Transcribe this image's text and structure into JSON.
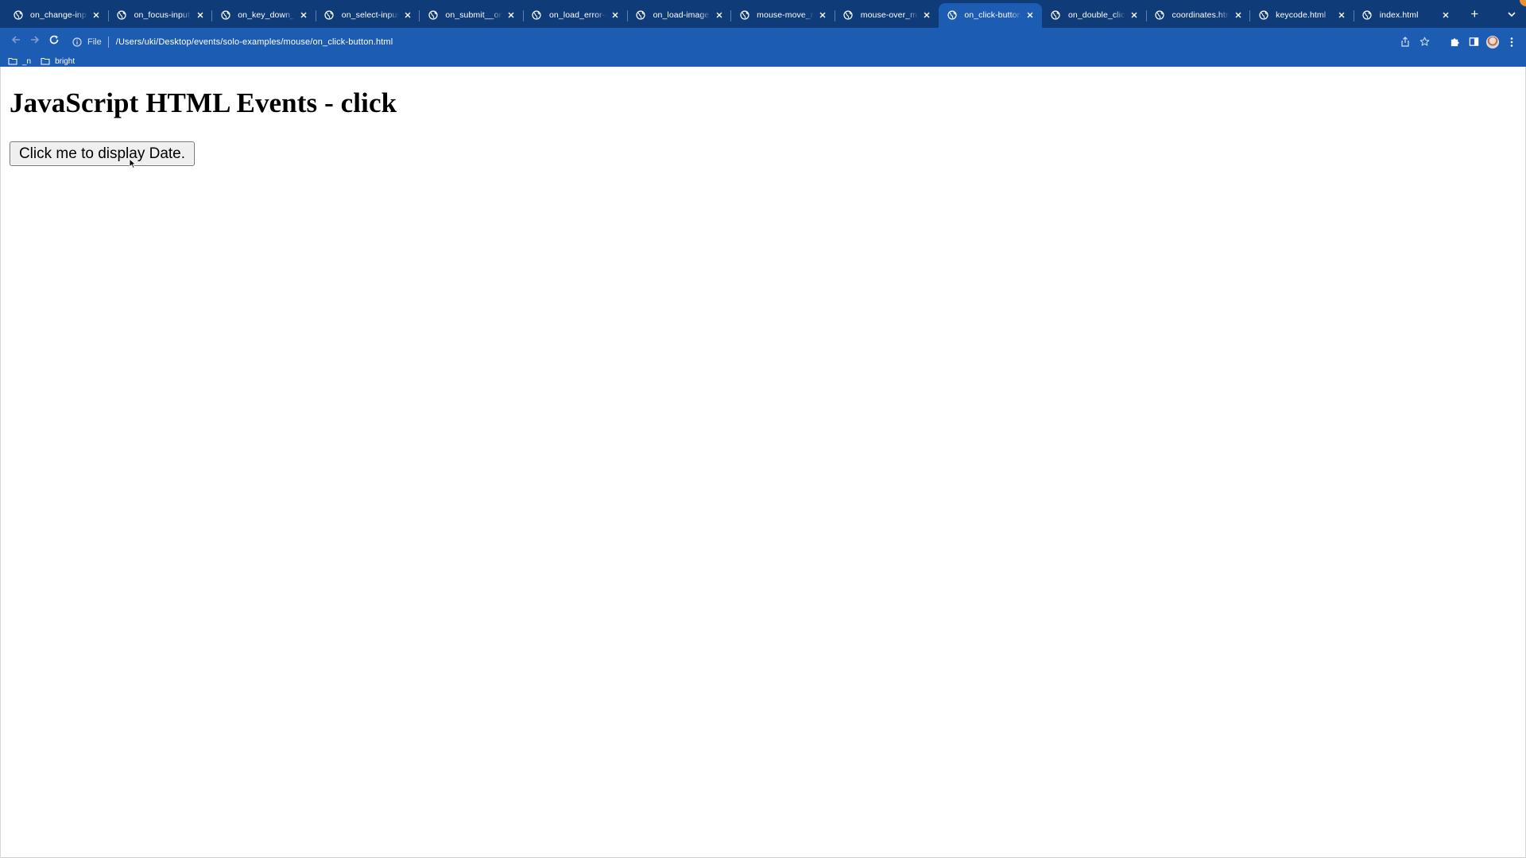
{
  "browser": {
    "tabs": [
      {
        "title": "on_change-input_field.html",
        "active": false
      },
      {
        "title": "on_focus-input_field.html",
        "active": false
      },
      {
        "title": "on_key_down__up.html",
        "active": false
      },
      {
        "title": "on_select-input_field.html",
        "active": false
      },
      {
        "title": "on_submit__on_reset.html",
        "active": false
      },
      {
        "title": "on_load_error-image.html",
        "active": false
      },
      {
        "title": "on_load-image.html",
        "active": false
      },
      {
        "title": "mouse-move_mouse.html",
        "active": false
      },
      {
        "title": "mouse-over_mouse.html",
        "active": false
      },
      {
        "title": "on_click-button.html",
        "active": true
      },
      {
        "title": "on_double_click-button.html",
        "active": false
      },
      {
        "title": "coordinates.html",
        "active": false
      },
      {
        "title": "keycode.html",
        "active": false
      },
      {
        "title": "index.html",
        "active": false
      }
    ],
    "new_tab_label": "+",
    "omnibox": {
      "scheme_label": "File",
      "url": "/Users/uki/Desktop/events/solo-examples/mouse/on_click-button.html"
    },
    "bookmarks": [
      {
        "label": "_n"
      },
      {
        "label": "bright"
      }
    ],
    "colors": {
      "tabstrip": "#0f3b78",
      "toolbar": "#1c5cb3",
      "page_background": "#ffffff"
    }
  },
  "page": {
    "heading": "JavaScript HTML Events - click",
    "button_label": "Click me to display Date."
  }
}
